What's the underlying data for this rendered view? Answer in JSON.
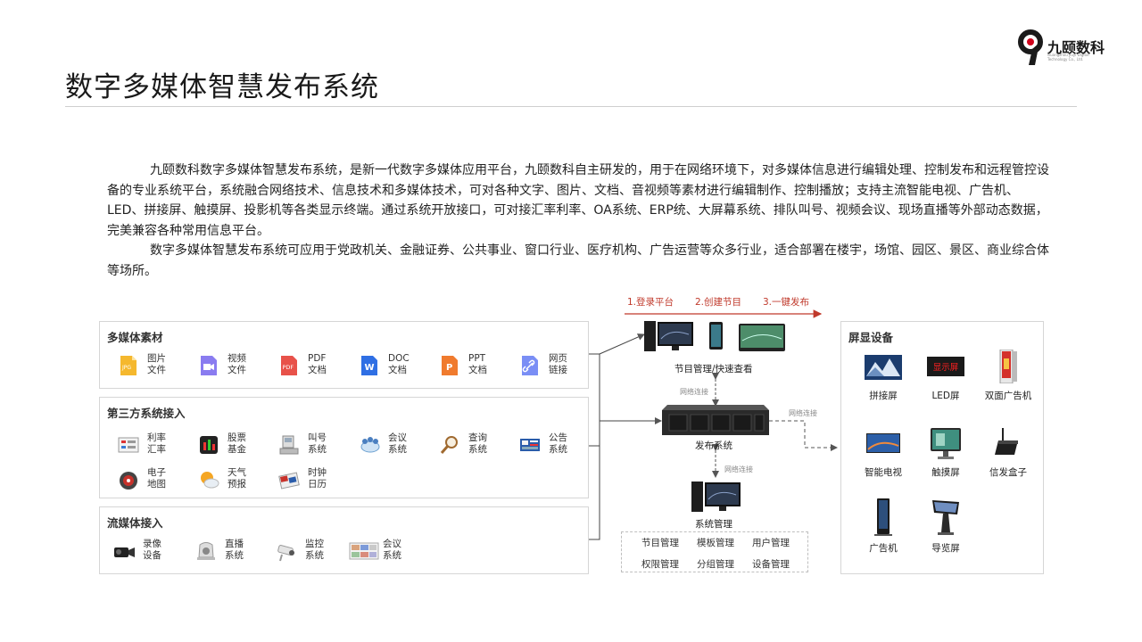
{
  "header": {
    "title": "数字多媒体智慧发布系统",
    "logo_name": "九颐数科",
    "logo_sub": "Guangzhou Jiuyi Digital Technology Co., Ltd."
  },
  "intro": {
    "p1": "九颐数科数字多媒体智慧发布系统，是新一代数字多媒体应用平台，九颐数科自主研发的，用于在网络环境下，对多媒体信息进行编辑处理、控制发布和远程管控设备的专业系统平台，系统融合网络技术、信息技术和多媒体技术，可对各种文字、图片、文档、音视频等素材进行编辑制作、控制播放；支持主流智能电视、广告机、LED、拼接屏、触摸屏、投影机等各类显示终端。通过系统开放接口，可对接汇率利率、OA系统、ERP统、大屏幕系统、排队叫号、视频会议、现场直播等外部动态数据，完美兼容各种常用信息平台。",
    "p2": "数字多媒体智慧发布系统可应用于党政机关、金融证券、公共事业、窗口行业、医疗机构、广告运营等众多行业，适合部署在楼宇，场馆、园区、景区、商业综合体等场所。"
  },
  "media": {
    "title": "多媒体素材",
    "items": [
      {
        "label": "图片\n文件",
        "icon": "image-file-icon"
      },
      {
        "label": "视频\n文件",
        "icon": "video-file-icon"
      },
      {
        "label": "PDF\n文档",
        "icon": "pdf-file-icon"
      },
      {
        "label": "DOC\n文档",
        "icon": "doc-file-icon"
      },
      {
        "label": "PPT\n文档",
        "icon": "ppt-file-icon"
      },
      {
        "label": "网页\n链接",
        "icon": "web-link-icon"
      }
    ]
  },
  "third": {
    "title": "第三方系统接入",
    "items": [
      {
        "label": "利率\n汇率",
        "icon": "exchange-rate-icon"
      },
      {
        "label": "股票\n基金",
        "icon": "stock-fund-icon"
      },
      {
        "label": "叫号\n系统",
        "icon": "queue-call-icon"
      },
      {
        "label": "会议\n系统",
        "icon": "meeting-system-icon"
      },
      {
        "label": "查询\n系统",
        "icon": "query-system-icon"
      },
      {
        "label": "公告\n系统",
        "icon": "notice-system-icon"
      },
      {
        "label": "电子\n地图",
        "icon": "e-map-icon"
      },
      {
        "label": "天气\n预报",
        "icon": "weather-icon"
      },
      {
        "label": "时钟\n日历",
        "icon": "clock-calendar-icon"
      }
    ]
  },
  "stream": {
    "title": "流媒体接入",
    "items": [
      {
        "label": "录像\n设备",
        "icon": "video-camera-icon"
      },
      {
        "label": "直播\n系统",
        "icon": "live-broadcast-icon"
      },
      {
        "label": "监控\n系统",
        "icon": "surveillance-icon"
      },
      {
        "label": "会议\n系统",
        "icon": "video-conference-icon"
      }
    ]
  },
  "flow": {
    "steps": [
      "1.登录平台",
      "2.创建节目",
      "3.一键发布"
    ],
    "program_caption": "节目管理/快速查看",
    "publish_caption": "发布系统",
    "mgmt_caption": "系统管理",
    "network_label": "网络连接",
    "mgmt_items": [
      "节目管理",
      "模板管理",
      "用户管理",
      "权限管理",
      "分组管理",
      "设备管理"
    ]
  },
  "screens": {
    "title": "屏显设备",
    "items": [
      {
        "label": "拼接屏",
        "icon": "splice-screen-icon"
      },
      {
        "label": "LED屏",
        "icon": "led-screen-icon",
        "led_text": "显示屏"
      },
      {
        "label": "双面广告机",
        "icon": "double-sided-ad-icon"
      },
      {
        "label": "智能电视",
        "icon": "smart-tv-icon"
      },
      {
        "label": "触摸屏",
        "icon": "touch-screen-icon"
      },
      {
        "label": "信发盒子",
        "icon": "signage-box-icon"
      },
      {
        "label": "广告机",
        "icon": "ad-machine-icon"
      },
      {
        "label": "导览屏",
        "icon": "guide-screen-icon"
      }
    ]
  },
  "colors": {
    "accent": "#c0392b",
    "border": "#d6d6d6",
    "line": "#555555"
  }
}
